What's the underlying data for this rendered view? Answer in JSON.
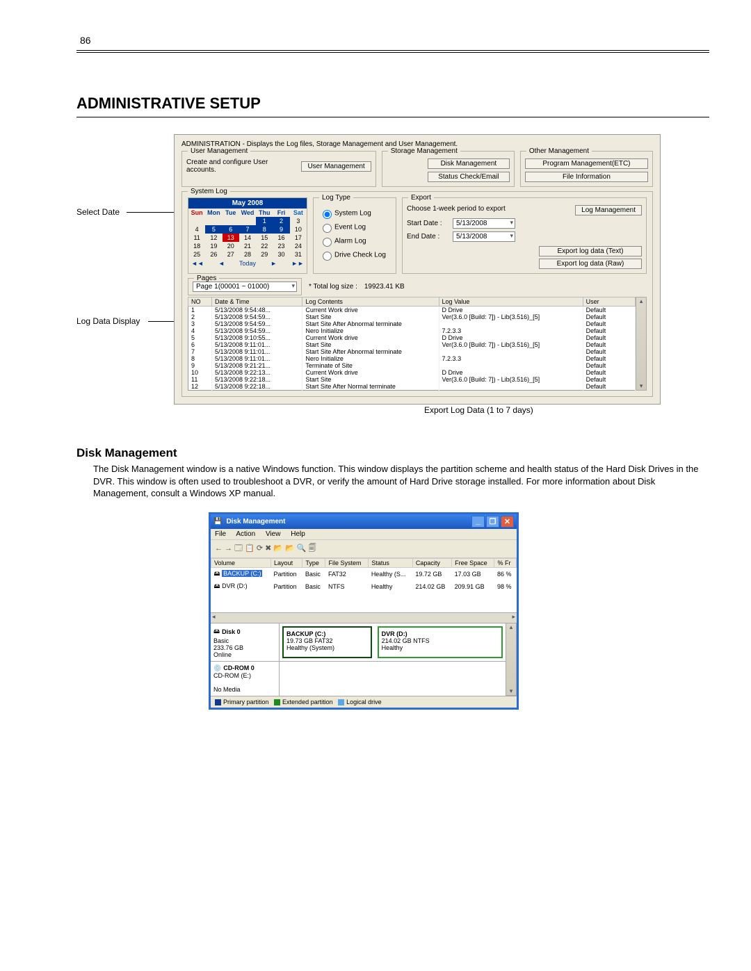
{
  "page_number": "86",
  "title": "ADMINISTRATIVE SETUP",
  "fig1": {
    "callouts": {
      "select_date": "Select Date",
      "log_data_display": "Log Data Display",
      "export_log_data": "Export Log Data (1 to 7 days)"
    },
    "desc": "ADMINISTRATION - Displays the Log files, Storage Management and User Management.",
    "user_mgmt": {
      "legend": "User Management",
      "text": "Create and configure User accounts.",
      "btn": "User Management"
    },
    "storage_mgmt": {
      "legend": "Storage Management",
      "btn_disk": "Disk Management",
      "btn_status": "Status Check/Email"
    },
    "other_mgmt": {
      "legend": "Other Management",
      "btn_prog": "Program Management(ETC)",
      "btn_file": "File Information"
    },
    "syslog": {
      "legend": "System Log",
      "cal_month": "May 2008",
      "dow": [
        "Sun",
        "Mon",
        "Tue",
        "Wed",
        "Thu",
        "Fri",
        "Sat"
      ],
      "weeks": [
        [
          "",
          "",
          "",
          "",
          "1",
          "2",
          "3"
        ],
        [
          "4",
          "5",
          "6",
          "7",
          "8",
          "9",
          "10"
        ],
        [
          "11",
          "12",
          "13",
          "14",
          "15",
          "16",
          "17"
        ],
        [
          "18",
          "19",
          "20",
          "21",
          "22",
          "23",
          "24"
        ],
        [
          "25",
          "26",
          "27",
          "28",
          "29",
          "30",
          "31"
        ]
      ],
      "today_label": "Today",
      "nav_prev2": "◄◄",
      "nav_prev": "◄",
      "nav_next": "►",
      "nav_next2": "►►"
    },
    "logtype": {
      "legend": "Log Type",
      "system": "System Log",
      "event": "Event Log",
      "alarm": "Alarm Log",
      "drive": "Drive Check Log"
    },
    "export": {
      "legend": "Export",
      "desc": "Choose 1-week period to export",
      "btn_mgmt": "Log Management",
      "start_label": "Start Date :",
      "start_val": "5/13/2008",
      "end_label": "End Date :",
      "end_val": "5/13/2008",
      "btn_text": "Export log data (Text)",
      "btn_raw": "Export log data (Raw)"
    },
    "pages": {
      "legend": "Pages",
      "val": "Page 1(00001 ~ 01000)",
      "total_label": "* Total log size :",
      "total_val": "19923.41 KB"
    },
    "log_cols": [
      "NO",
      "Date & Time",
      "Log Contents",
      "Log Value",
      "User"
    ],
    "log_rows": [
      [
        "1",
        "5/13/2008 9:54:48...",
        "Current Work drive",
        "D Drive",
        "Default"
      ],
      [
        "2",
        "5/13/2008 9:54:59...",
        "Start Site",
        "Ver(3.6.0 [Build:  7]) - Lib(3.516)_[5]",
        "Default"
      ],
      [
        "3",
        "5/13/2008 9:54:59...",
        "Start Site After Abnormal terminate",
        "",
        "Default"
      ],
      [
        "4",
        "5/13/2008 9:54:59...",
        "Nero Initialize",
        "7.2.3.3",
        "Default"
      ],
      [
        "5",
        "5/13/2008 9:10:55...",
        "Current Work drive",
        "D Drive",
        "Default"
      ],
      [
        "6",
        "5/13/2008 9:11:01...",
        "Start Site",
        "Ver(3.6.0 [Build:  7]) - Lib(3.516)_[5]",
        "Default"
      ],
      [
        "7",
        "5/13/2008 9:11:01...",
        "Start Site After Abnormal terminate",
        "",
        "Default"
      ],
      [
        "8",
        "5/13/2008 9:11:01...",
        "Nero Initialize",
        "7.2.3.3",
        "Default"
      ],
      [
        "9",
        "5/13/2008 9:21:21...",
        "Terminate of Site",
        "",
        "Default"
      ],
      [
        "10",
        "5/13/2008 9:22:13...",
        "Current Work drive",
        "D Drive",
        "Default"
      ],
      [
        "11",
        "5/13/2008 9:22:18...",
        "Start Site",
        "Ver(3.6.0 [Build:  7]) - Lib(3.516)_[5]",
        "Default"
      ],
      [
        "12",
        "5/13/2008 9:22:18...",
        "Start Site After Normal terminate",
        "",
        "Default"
      ]
    ]
  },
  "disk_mgmt": {
    "heading": "Disk Management",
    "paragraph": "The Disk Management window is a native Windows function. This window displays the partition scheme and health status of the Hard Disk Drives in the DVR. This window is often used to troubleshoot a DVR, or verify the amount of Hard Drive storage installed. For more information about Disk Management, consult a Windows XP manual.",
    "window": {
      "title": "Disk Management",
      "menu": [
        "File",
        "Action",
        "View",
        "Help"
      ],
      "toolbar": "←  →   🗔  📋     ⟳ ✖ 📂 📂 🔍 🗐",
      "vol_cols": [
        "Volume",
        "Layout",
        "Type",
        "File System",
        "Status",
        "Capacity",
        "Free Space",
        "% Fr"
      ],
      "vol_rows": [
        [
          "BACKUP (C:)",
          "Partition",
          "Basic",
          "FAT32",
          "Healthy (S...",
          "19.72 GB",
          "17.03 GB",
          "86 %"
        ],
        [
          "DVR (D:)",
          "Partition",
          "Basic",
          "NTFS",
          "Healthy",
          "214.02 GB",
          "209.91 GB",
          "98 %"
        ]
      ],
      "disk0": {
        "label": "Disk 0",
        "sub1": "Basic",
        "sub2": "233.76 GB",
        "sub3": "Online",
        "p1_name": "BACKUP (C:)",
        "p1_sub": "19.73 GB FAT32",
        "p1_stat": "Healthy (System)",
        "p2_name": "DVR (D:)",
        "p2_sub": "214.02 GB NTFS",
        "p2_stat": "Healthy"
      },
      "cdrom": {
        "label": "CD-ROM 0",
        "sub1": "CD-ROM (E:)",
        "sub2": "No Media"
      },
      "legend": {
        "pp": "Primary partition",
        "ep": "Extended partition",
        "ld": "Logical drive"
      }
    }
  }
}
